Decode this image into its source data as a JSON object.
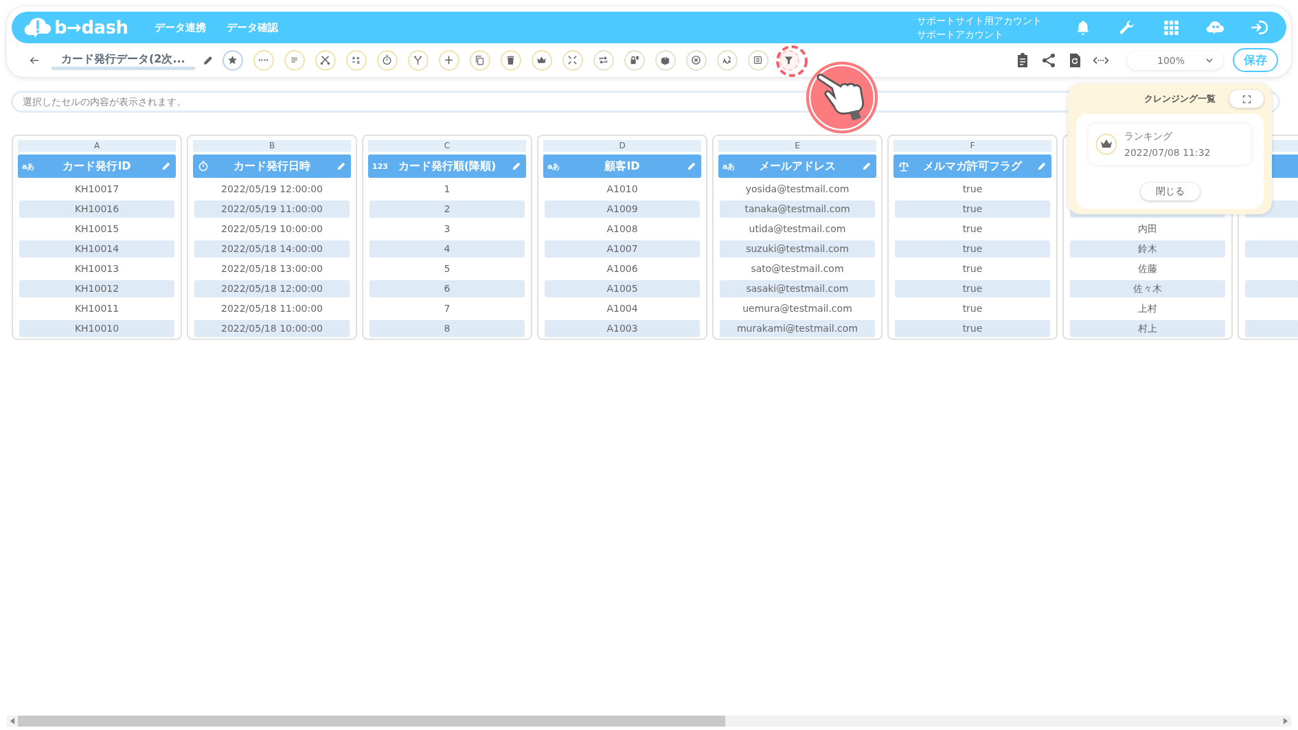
{
  "header": {
    "logo": "b→dash",
    "nav": [
      "データ連携",
      "データ確認"
    ],
    "account": [
      "サポートサイト用アカウント",
      "サポートアカウント"
    ]
  },
  "toolbar": {
    "title": "カード発行データ(2次...",
    "tools": [
      {
        "color": "#b9d3ec",
        "selected": false
      },
      {
        "color": "#f3e2b0",
        "selected": false
      },
      {
        "color": "#f3e2b0",
        "selected": false
      },
      {
        "color": "#f3e2b0",
        "selected": false
      },
      {
        "color": "#f3e2b0",
        "selected": false
      },
      {
        "color": "#f3e2b0",
        "selected": false
      },
      {
        "color": "#f3e2b0",
        "selected": false
      },
      {
        "color": "#f3e2b0",
        "selected": false
      },
      {
        "color": "#f3e2b0",
        "selected": false
      },
      {
        "color": "#f3e2b0",
        "selected": false
      },
      {
        "color": "#f3e2b0",
        "selected": false
      },
      {
        "color": "#f3e2b0",
        "selected": false
      },
      {
        "color": "#dfe6c8",
        "selected": false
      },
      {
        "color": "#dfe6c8",
        "selected": false
      },
      {
        "color": "#dfe6c8",
        "selected": false
      },
      {
        "color": "#dfe6c8",
        "selected": false
      },
      {
        "color": "#dfe6c8",
        "selected": false
      },
      {
        "color": "#dfe6c8",
        "selected": false
      },
      {
        "color": "#f6c8c8",
        "selected": true
      }
    ],
    "zoom": "100%",
    "save": "保存"
  },
  "cell_viewer": {
    "placeholder": "選択したセルの内容が表示されます。"
  },
  "columns": [
    {
      "letter": "A",
      "kind": "text",
      "type_label": "aあ",
      "title": "カード発行ID",
      "cells": [
        "KH10017",
        "KH10016",
        "KH10015",
        "KH10014",
        "KH10013",
        "KH10012",
        "KH10011",
        "KH10010"
      ]
    },
    {
      "letter": "B",
      "kind": "datetime",
      "title": "カード発行日時",
      "cells": [
        "2022/05/19 12:00:00",
        "2022/05/19 11:00:00",
        "2022/05/19 10:00:00",
        "2022/05/18 14:00:00",
        "2022/05/18 13:00:00",
        "2022/05/18 12:00:00",
        "2022/05/18 11:00:00",
        "2022/05/18 10:00:00"
      ]
    },
    {
      "letter": "C",
      "kind": "number",
      "type_label": "123",
      "title": "カード発行順(降順)",
      "cells": [
        "1",
        "2",
        "3",
        "4",
        "5",
        "6",
        "7",
        "8"
      ]
    },
    {
      "letter": "D",
      "kind": "text",
      "type_label": "aあ",
      "title": "顧客ID",
      "cells": [
        "A1010",
        "A1009",
        "A1008",
        "A1007",
        "A1006",
        "A1005",
        "A1004",
        "A1003"
      ]
    },
    {
      "letter": "E",
      "kind": "text",
      "type_label": "aあ",
      "title": "メールアドレス",
      "cells": [
        "yosida@testmail.com",
        "tanaka@testmail.com",
        "utida@testmail.com",
        "suzuki@testmail.com",
        "sato@testmail.com",
        "sasaki@testmail.com",
        "uemura@testmail.com",
        "murakami@testmail.com"
      ]
    },
    {
      "letter": "F",
      "kind": "flag",
      "title": "メルマガ許可フラグ",
      "cells": [
        "true",
        "true",
        "true",
        "true",
        "true",
        "true",
        "true",
        "true"
      ]
    },
    {
      "cells": [
        null,
        null,
        "内田",
        "鈴木",
        "佐藤",
        "佐々木",
        "上村",
        "村上"
      ]
    }
  ],
  "cleansing_panel": {
    "title": "クレンジング一覧",
    "items": [
      {
        "name": "ランキング",
        "time": "2022/07/08 11:32"
      }
    ],
    "close": "閉じる"
  }
}
